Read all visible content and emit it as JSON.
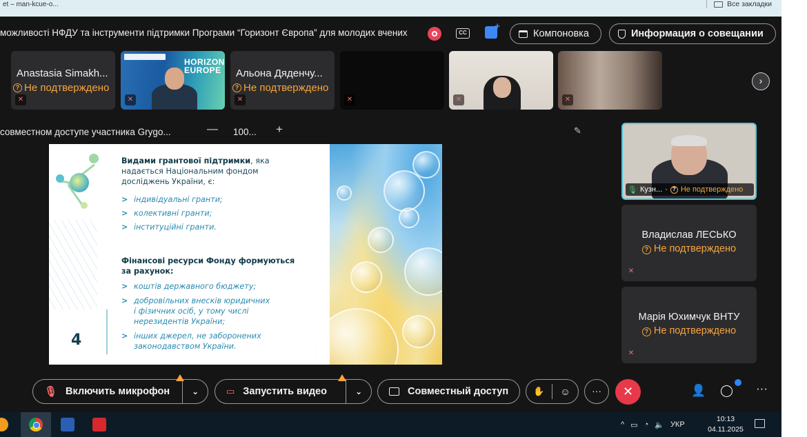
{
  "browser": {
    "tab_title": "et – man-kcue-o...",
    "bookmarks_label": "Все закладки"
  },
  "meeting": {
    "title": "можливості НФДУ та інструменти підтримки Програми “Горизонт Європа” для молодих вчених",
    "layout_button": "Компоновка",
    "info_button": "Информация о совещании",
    "cc_label": "CC"
  },
  "participants": [
    {
      "name": "Anastasia Simakh...",
      "status": "Не подтверждено"
    },
    {
      "name": "",
      "status": ""
    },
    {
      "name": "Альона Дяденчу...",
      "status": "Не подтверждено"
    },
    {
      "name": "",
      "status": ""
    },
    {
      "name": "",
      "status": ""
    },
    {
      "name": "",
      "status": ""
    }
  ],
  "horizon_text": "HORIZON EUROPE",
  "share": {
    "label": "совместном доступе участника Grygo...",
    "zoom_minus": "—",
    "zoom_value": "100...",
    "zoom_plus": "+"
  },
  "slide": {
    "intro_bold": "Видами грантової підтримки",
    "intro_rest_1": ", яка",
    "intro_line_2": "надається Національним фондом",
    "intro_line_3": "досліджень України, є:",
    "grant_types": [
      "індивідуальні гранти;",
      "колективні гранти;",
      "інституційні гранти."
    ],
    "finance_line_1": "Фінансові ресурси Фонду формуються",
    "finance_line_2": "за рахунок:",
    "finance_items": [
      [
        "коштів державного бюджету;"
      ],
      [
        "добровільних внесків юридичних",
        "і фізичних осіб, у тому числі",
        "нерезидентів України;"
      ],
      [
        "інших джерел, не заборонених",
        "законодавством України."
      ]
    ],
    "page_number": "4"
  },
  "side_tiles": {
    "active_name": "Кузн...",
    "active_status": "Не подтверждено",
    "tile2_name": "Владислав ЛЕСЬКО",
    "tile2_status": "Не подтверждено",
    "tile3_name": "Марія Юхимчук ВНТУ",
    "tile3_status": "Не подтверждено"
  },
  "controls": {
    "mic_label": "Включить микрофон",
    "video_label": "Запустить видео",
    "share_label": "Совместный доступ",
    "more_label": "···",
    "end_label": "✕"
  },
  "taskbar": {
    "language": "УКР",
    "time": "10:13",
    "date": "04.11.2025"
  },
  "colors": {
    "accent": "#4fc3d9",
    "warning": "#f7a53c",
    "end_call": "#e8394a",
    "background": "#151516"
  }
}
